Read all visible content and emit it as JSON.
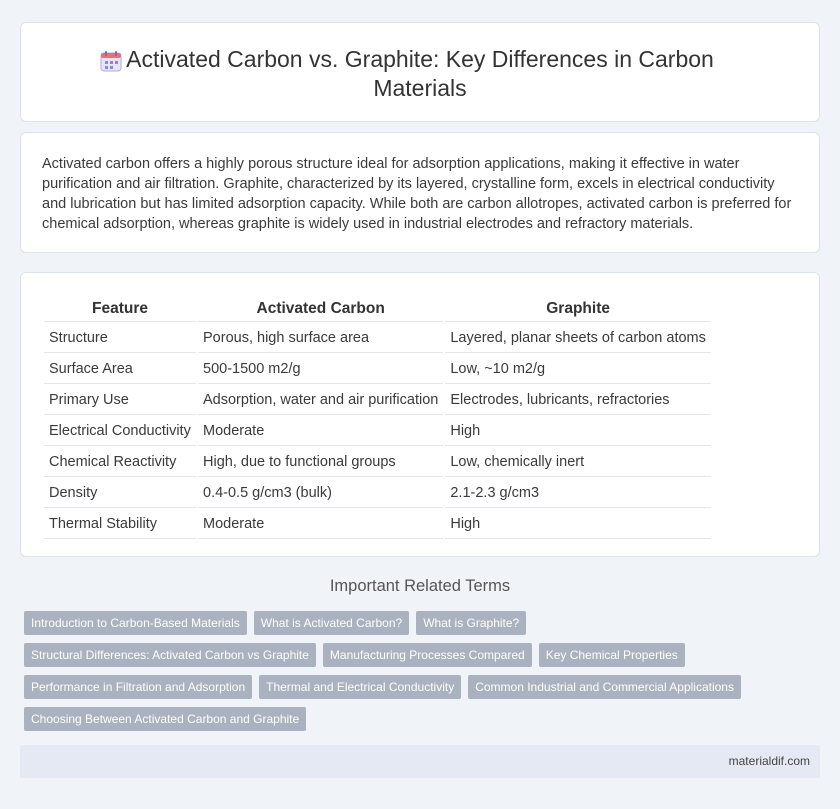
{
  "header": {
    "title": "Activated Carbon vs. Graphite: Key Differences in Carbon Materials",
    "icon": "calendar-icon"
  },
  "intro": {
    "text": "Activated carbon offers a highly porous structure ideal for adsorption applications, making it effective in water purification and air filtration. Graphite, characterized by its layered, crystalline form, excels in electrical conductivity and lubrication but has limited adsorption capacity. While both are carbon allotropes, activated carbon is preferred for chemical adsorption, whereas graphite is widely used in industrial electrodes and refractory materials."
  },
  "table": {
    "headers": [
      "Feature",
      "Activated Carbon",
      "Graphite"
    ],
    "rows": [
      [
        "Structure",
        "Porous, high surface area",
        "Layered, planar sheets of carbon atoms"
      ],
      [
        "Surface Area",
        "500-1500 m2/g",
        "Low, ~10 m2/g"
      ],
      [
        "Primary Use",
        "Adsorption, water and air purification",
        "Electrodes, lubricants, refractories"
      ],
      [
        "Electrical Conductivity",
        "Moderate",
        "High"
      ],
      [
        "Chemical Reactivity",
        "High, due to functional groups",
        "Low, chemically inert"
      ],
      [
        "Density",
        "0.4-0.5 g/cm3 (bulk)",
        "2.1-2.3 g/cm3"
      ],
      [
        "Thermal Stability",
        "Moderate",
        "High"
      ]
    ]
  },
  "related": {
    "title": "Important Related Terms",
    "tags": [
      "Introduction to Carbon-Based Materials",
      "What is Activated Carbon?",
      "What is Graphite?",
      "Structural Differences: Activated Carbon vs Graphite",
      "Manufacturing Processes Compared",
      "Key Chemical Properties",
      "Performance in Filtration and Adsorption",
      "Thermal and Electrical Conductivity",
      "Common Industrial and Commercial Applications",
      "Choosing Between Activated Carbon and Graphite"
    ]
  },
  "footer": {
    "site": "materialdif.com"
  },
  "colors": {
    "background": "#f0f3f8",
    "tag": "#aab2bf",
    "footer": "#e4e9f3"
  }
}
